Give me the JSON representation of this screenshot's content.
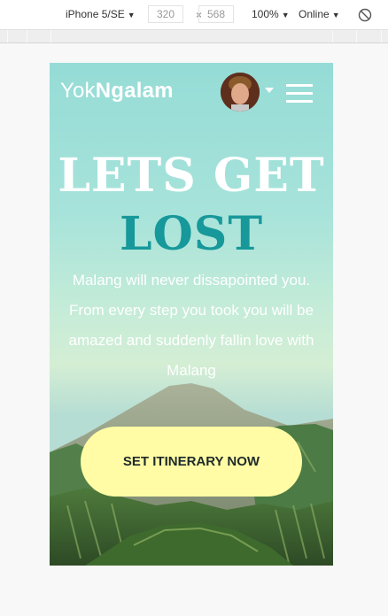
{
  "devtools": {
    "device": "iPhone 5/SE",
    "width": "320",
    "times": "×",
    "height": "568",
    "zoom": "100%",
    "network": "Online",
    "caret": "▼",
    "rotate_icon": "rotate-icon"
  },
  "header": {
    "brand_light": "Yok",
    "brand_bold": "Ngalam",
    "avatar_icon": "avatar",
    "menu_icon": "hamburger-icon"
  },
  "hero": {
    "headline_line1": "LETS GET",
    "headline_line2": "LOST",
    "intro_text": "Malang will never dissapointed you. From every step you took you will be amazed and suddenly fallin love with Malang",
    "cta_label": "SET ITINERARY NOW"
  },
  "colors": {
    "accent_teal": "#17989a",
    "cta_yellow": "#fffca5",
    "sky_top": "#95dcd6"
  }
}
